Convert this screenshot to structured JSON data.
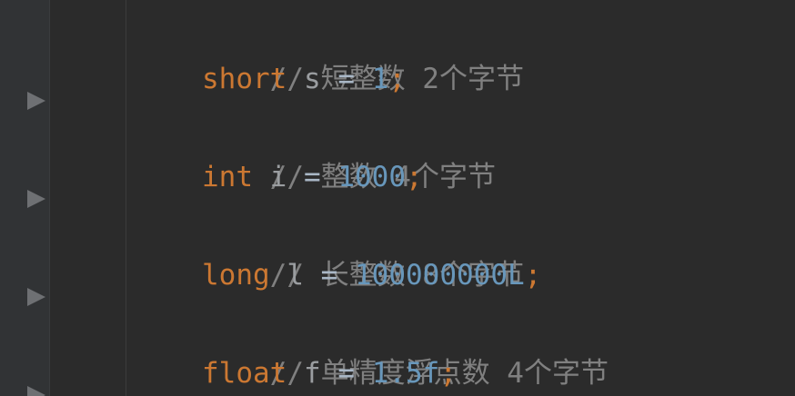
{
  "editor": {
    "colors": {
      "background": "#2b2b2b",
      "gutter": "#313335",
      "comment": "#808080",
      "keyword": "#cc7832",
      "number": "#6897bb",
      "identifier": "#9a9da0",
      "operator": "#a9b7c6"
    },
    "lines": [
      {
        "comment": "// 短整数 2个字节"
      },
      {
        "keyword": "short",
        "name": "s",
        "op": "=",
        "value": "1",
        "semi": ";"
      },
      {
        "comment": "// 整数 4个字节"
      },
      {
        "keyword": "int",
        "name": "i",
        "op": "=",
        "value": "1000",
        "semi": ";"
      },
      {
        "comment": "// 长整数 8个字节"
      },
      {
        "keyword": "long",
        "name": "l",
        "op": "=",
        "value": "100000000L",
        "semi": ";"
      },
      {
        "comment": "// 单精度浮点数 4个字节"
      },
      {
        "keyword": "float",
        "name": "f",
        "op": "=",
        "value": "1.5f",
        "semi": ";"
      }
    ]
  }
}
